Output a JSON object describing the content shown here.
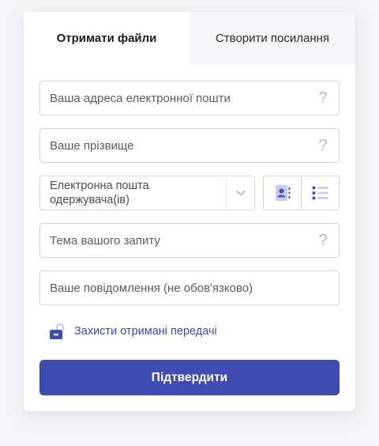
{
  "tabs": [
    {
      "label": "Отримати файли",
      "active": true
    },
    {
      "label": "Створити посилання",
      "active": false
    }
  ],
  "form": {
    "email_placeholder": "Ваша адреса електронної пошти",
    "surname_placeholder": "Ваше прізвище",
    "recipients_placeholder": "Електронна пошта\nодержувача(ів)",
    "subject_placeholder": "Тема вашого запиту",
    "message_placeholder": "Ваше повідомлення (не обов'язково)",
    "help_glyph": "?"
  },
  "protect_label": "Захисти отримані передачі",
  "submit_label": "Підтвердити",
  "colors": {
    "accent": "#3f4db3",
    "link": "#3d4aa8",
    "icon_fill": "#c7cbef",
    "icon_stroke": "#3f4db3",
    "page_bg": "#f4f5f9"
  },
  "icons": {
    "help": "question-icon",
    "dropdown": "chevron-down-icon",
    "contacts": "address-book-icon",
    "list": "list-icon",
    "lock": "unlocked-padlock-icon"
  }
}
